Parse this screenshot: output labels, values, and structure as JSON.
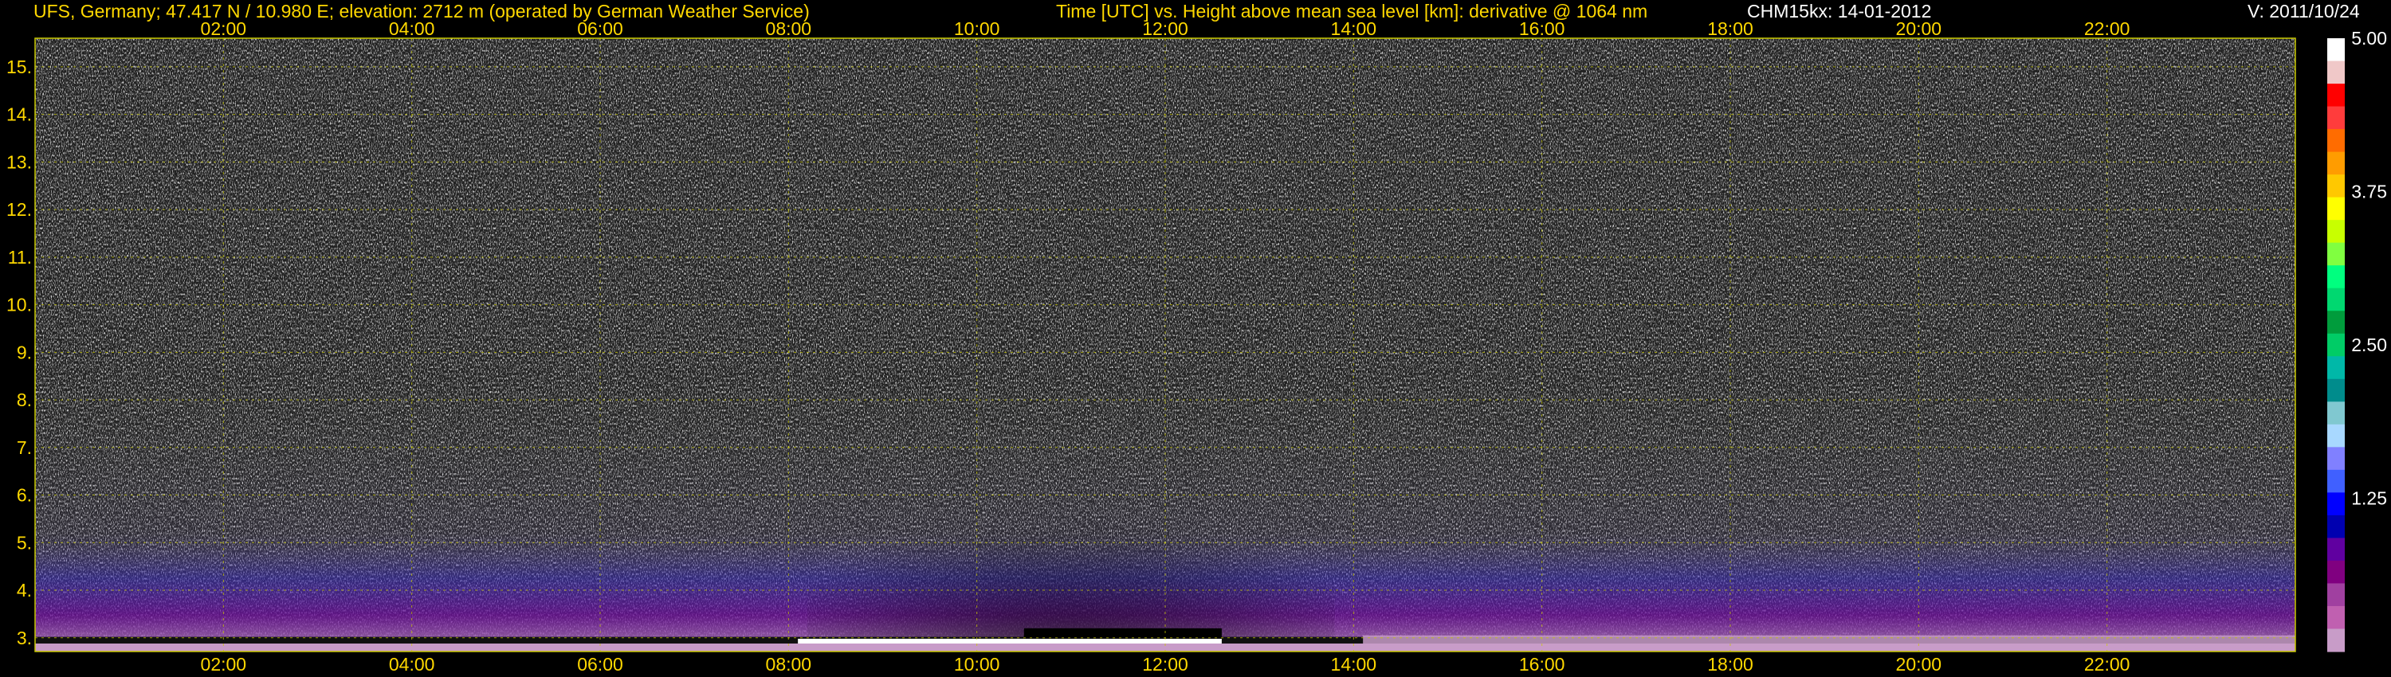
{
  "header": {
    "station": "UFS, Germany; 47.417 N / 10.980 E; elevation: 2712 m  (operated by German Weather Service)",
    "axis_description": "Time [UTC] vs. Height above mean sea level [km]: derivative @ 1064 nm",
    "instrument_date": "CHM15kx: 14-01-2012",
    "version": "V: 2011/10/24"
  },
  "chart_data": {
    "type": "heatmap",
    "x_ticks": [
      "02:00",
      "04:00",
      "06:00",
      "08:00",
      "10:00",
      "12:00",
      "14:00",
      "16:00",
      "18:00",
      "20:00",
      "22:00"
    ],
    "x_tick_hours": [
      2,
      4,
      6,
      8,
      10,
      12,
      14,
      16,
      18,
      20,
      22
    ],
    "xlim_hours": [
      0,
      24
    ],
    "y_ticks": [
      "3.",
      "4.",
      "5.",
      "6.",
      "7.",
      "8.",
      "9.",
      "10.",
      "11.",
      "12.",
      "13.",
      "14.",
      "15."
    ],
    "y_tick_values": [
      3,
      4,
      5,
      6,
      7,
      8,
      9,
      10,
      11,
      12,
      13,
      14,
      15
    ],
    "ylim_km": [
      2.712,
      15.6
    ],
    "grid": true,
    "colorbar": {
      "ticks": [
        "5.00",
        "3.75",
        "2.50",
        "1.25"
      ],
      "tick_values": [
        5.0,
        3.75,
        2.5,
        1.25
      ],
      "range": [
        0,
        5.0
      ],
      "colors": [
        "#ffffff",
        "#f0c8c8",
        "#ff0000",
        "#ff3c3c",
        "#ff6c00",
        "#ff9c00",
        "#ffc800",
        "#ffff00",
        "#c8ff00",
        "#80ff40",
        "#00ff7f",
        "#00d870",
        "#009c3c",
        "#00cc66",
        "#00b8a8",
        "#008c8c",
        "#80c8d0",
        "#a8d8ff",
        "#8080ff",
        "#4060ff",
        "#0000ff",
        "#0000b0",
        "#6000a0",
        "#800080",
        "#a040a0",
        "#c060b0",
        "#c89cc8"
      ]
    },
    "colors": {
      "text": "#ffd800",
      "grid": "#c8c800",
      "axis_frame": "#c8c800"
    }
  }
}
